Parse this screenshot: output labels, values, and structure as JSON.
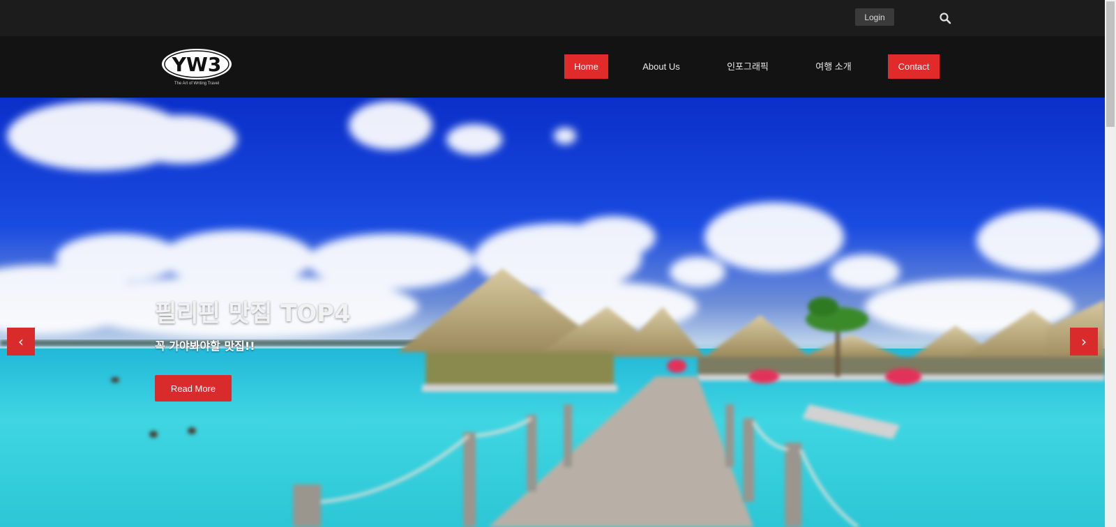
{
  "topbar": {
    "login_label": "Login",
    "search_icon": "search-icon"
  },
  "logo": {
    "text": "YW3",
    "subtext": "The Art of Writing Travel"
  },
  "nav": {
    "items": [
      {
        "label": "Home",
        "active": true
      },
      {
        "label": "About Us",
        "active": false
      },
      {
        "label": "인포그래픽",
        "active": false
      },
      {
        "label": "여행 소개",
        "active": false
      },
      {
        "label": "Contact",
        "active": true
      }
    ]
  },
  "hero": {
    "title": "필리핀 맛집 TOP4",
    "subtitle": "꼭 가야봐야할 맛집!!",
    "button_label": "Read More",
    "prev_icon": "chevron-left-icon",
    "next_icon": "chevron-right-icon",
    "prev_glyph": "‹",
    "next_glyph": "›"
  },
  "colors": {
    "accent": "#e12b2b",
    "topbar": "#1c1c1c",
    "navbar": "#131313",
    "sky": "#1a4be0",
    "water": "#2fcfe0"
  }
}
